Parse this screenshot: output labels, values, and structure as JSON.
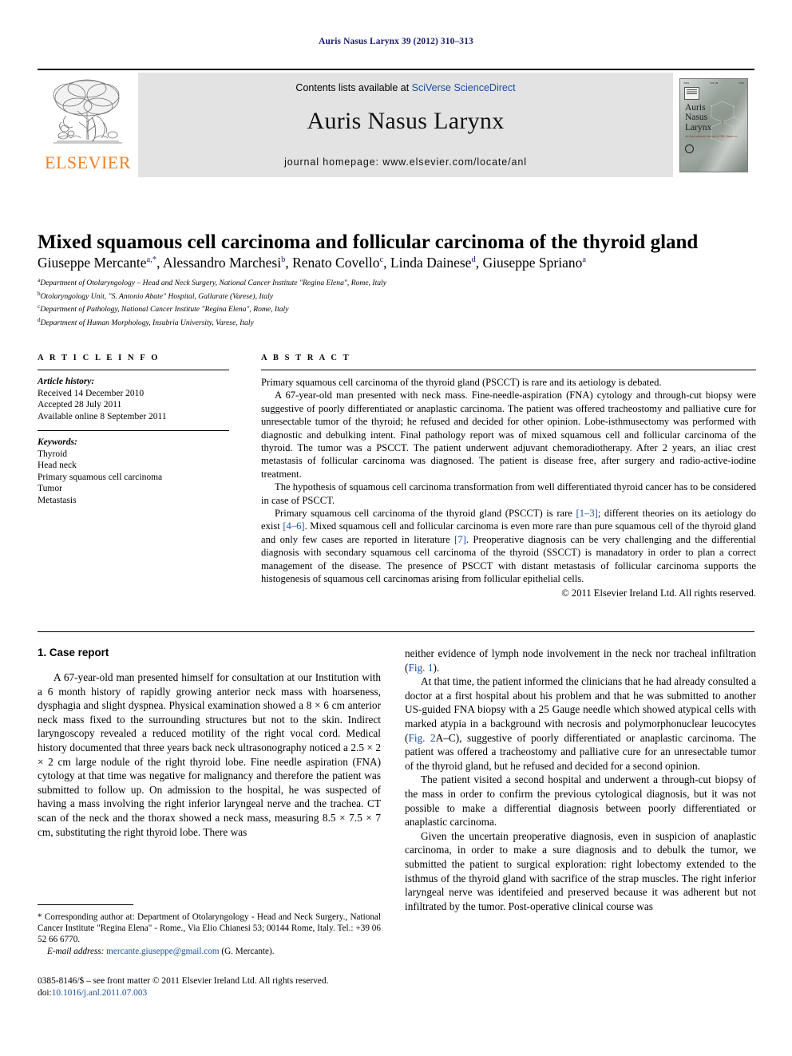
{
  "running_head": "Auris Nasus Larynx 39 (2012) 310–313",
  "masthead": {
    "publisher_name": "ELSEVIER",
    "publisher_logo": "elsevier-tree-logo",
    "contents_prefix": "Contents lists available at ",
    "contents_link": "SciVerse ScienceDirect",
    "journal_title": "Auris Nasus Larynx",
    "homepage": "journal homepage: www.elsevier.com/locate/anl",
    "cover": {
      "title_line1": "Auris",
      "title_line2": "Nasus",
      "title_line3": "Larynx",
      "subtitle": "An International Journal\nof ORL Sciences"
    }
  },
  "article": {
    "title": "Mixed squamous cell carcinoma and follicular carcinoma of the thyroid gland",
    "authors_html": "Giuseppe Mercante<sup>a,*</sup>, Alessandro Marchesi<sup>b</sup>, Renato Covello<sup>c</sup>, Linda Dainese<sup>d</sup>, Giuseppe Spriano<sup>a</sup>",
    "affiliations": [
      {
        "mark": "a",
        "text": "Department of Otolaryngology – Head and Neck Surgery, National Cancer Institute \"Regina Elena\", Rome, Italy"
      },
      {
        "mark": "b",
        "text": "Otolaryngology Unit, \"S. Antonio Abate\" Hospital, Gallarate (Varese), Italy"
      },
      {
        "mark": "c",
        "text": "Department of Pathology, National Cancer Institute \"Regina Elena\", Rome, Italy"
      },
      {
        "mark": "d",
        "text": "Department of Human Morphology, Insubria University, Varese, Italy"
      }
    ]
  },
  "article_info": {
    "heading": "A R T I C L E   I N F O",
    "history_label": "Article history:",
    "history": [
      "Received 14 December 2010",
      "Accepted 28 July 2011",
      "Available online 8 September 2011"
    ],
    "keywords_label": "Keywords:",
    "keywords": [
      "Thyroid",
      "Head neck",
      "Primary squamous cell carcinoma",
      "Tumor",
      "Metastasis"
    ]
  },
  "abstract": {
    "heading": "A B S T R A C T",
    "paragraphs": [
      "Primary squamous cell carcinoma of the thyroid gland (PSCCT) is rare and its aetiology is debated.",
      "A 67-year-old man presented with neck mass. Fine-needle-aspiration (FNA) cytology and through-cut biopsy were suggestive of poorly differentiated or anaplastic carcinoma. The patient was offered tracheostomy and palliative cure for unresectable tumor of the thyroid; he refused and decided for other opinion. Lobe-isthmusectomy was performed with diagnostic and debulking intent. Final pathology report was of mixed squamous cell and follicular carcinoma of the thyroid. The tumor was a PSCCT. The patient underwent adjuvant chemoradiotherapy. After 2 years, an iliac crest metastasis of follicular carcinoma was diagnosed. The patient is disease free, after surgery and radio-active-iodine treatment.",
      "The hypothesis of squamous cell carcinoma transformation from well differentiated thyroid cancer has to be considered in case of PSCCT."
    ],
    "last_paragraph_segments": [
      {
        "text": "Primary squamous cell carcinoma of the thyroid gland (PSCCT) is rare ",
        "link": false
      },
      {
        "text": "[1–3]",
        "link": true
      },
      {
        "text": "; different theories on its aetiology do exist ",
        "link": false
      },
      {
        "text": "[4–6]",
        "link": true
      },
      {
        "text": ". Mixed squamous cell and follicular carcinoma is even more rare than pure squamous cell of the thyroid gland and only few cases are reported in literature ",
        "link": false
      },
      {
        "text": "[7]",
        "link": true
      },
      {
        "text": ". Preoperative diagnosis can be very challenging and the differential diagnosis with secondary squamous cell carcinoma of the thyroid (SSCCT) is manadatory in order to plan a correct management of the disease. The presence of PSCCT with distant metastasis of follicular carcinoma supports the histogenesis of squamous cell carcinomas arising from follicular epithelial cells.",
        "link": false
      }
    ],
    "copyright": "© 2011 Elsevier Ireland Ltd. All rights reserved."
  },
  "body": {
    "section_title": "1. Case report",
    "left_paragraphs": [
      "A 67-year-old man presented himself for consultation at our Institution with a 6 month history of rapidly growing anterior neck mass with hoarseness, dysphagia and slight dyspnea. Physical examination showed a 8 × 6 cm anterior neck mass fixed to the surrounding structures but not to the skin. Indirect laryngoscopy revealed a reduced motility of the right vocal cord. Medical history documented that three years back neck ultrasonography noticed a 2.5 × 2 × 2 cm large nodule of the right thyroid lobe. Fine needle aspiration (FNA) cytology at that time was negative for malignancy and therefore the patient was submitted to follow up. On admission to the hospital, he was suspected of having a mass involving the right inferior laryngeal nerve and the trachea. CT scan of the neck and the thorax showed a neck mass, measuring 8.5 × 7.5 × 7 cm, substituting the right thyroid lobe. There was"
    ],
    "right_paragraph_1_segments": [
      {
        "text": "neither evidence of lymph node involvement in the neck nor tracheal infiltration (",
        "link": false
      },
      {
        "text": "Fig. 1",
        "link": true
      },
      {
        "text": ").",
        "link": false
      }
    ],
    "right_paragraph_2_segments": [
      {
        "text": "At that time, the patient informed the clinicians that he had already consulted a doctor at a first hospital about his problem and that he was submitted to another US-guided FNA biopsy with a 25 Gauge needle which showed atypical cells with marked atypia in a background with necrosis and polymorphonuclear leucocytes (",
        "link": false
      },
      {
        "text": "Fig. 2",
        "link": true
      },
      {
        "text": "A–C), suggestive of poorly differentiated or anaplastic carcinoma. The patient was offered a tracheostomy and palliative cure for an unresectable tumor of the thyroid gland, but he refused and decided for a second opinion.",
        "link": false
      }
    ],
    "right_paragraphs_rest": [
      "The patient visited a second hospital and underwent a through-cut biopsy of the mass in order to confirm the previous cytological diagnosis, but it was not possible to make a differential diagnosis between poorly differentiated or anaplastic carcinoma.",
      "Given the uncertain preoperative diagnosis, even in suspicion of anaplastic carcinoma, in order to make a sure diagnosis and to debulk the tumor, we submitted the patient to surgical exploration: right lobectomy extended to the isthmus of the thyroid gland with sacrifice of the strap muscles. The right inferior laryngeal nerve was identifeied and preserved because it was adherent but not infiltrated by the tumor. Post-operative clinical course was"
    ]
  },
  "footnotes": {
    "corresponding": "* Corresponding author at: Department of Otolaryngology - Head and Neck Surgery., National Cancer Institute \"Regina Elena\" - Rome., Via Elio Chianesi 53; 00144 Rome, Italy. Tel.: +39 06 52 66 6770.",
    "email_label": "E-mail address:",
    "email": "mercante.giuseppe@gmail.com",
    "email_suffix": "(G. Mercante).",
    "issn_line": "0385-8146/$ – see front matter © 2011 Elsevier Ireland Ltd. All rights reserved.",
    "doi_label": "doi:",
    "doi": "10.1016/j.anl.2011.07.003"
  },
  "colors": {
    "link": "#1a4fa0",
    "runhead": "#1a1a6e",
    "elsevier_orange": "#f28022",
    "masthead_bg": "#e3e3e3"
  }
}
